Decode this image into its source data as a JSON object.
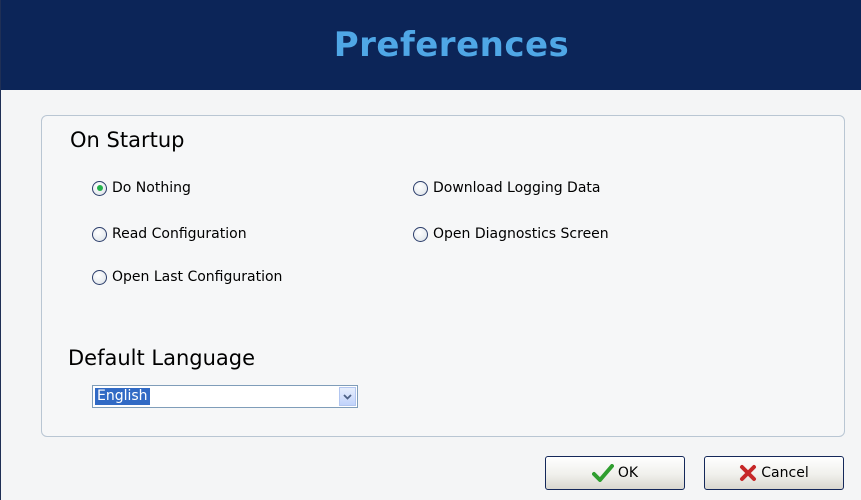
{
  "window": {
    "title": "Preferences"
  },
  "startup": {
    "title": "On Startup",
    "options": [
      {
        "label": "Do Nothing",
        "selected": true
      },
      {
        "label": "Read Configuration",
        "selected": false
      },
      {
        "label": "Open Last Configuration",
        "selected": false
      },
      {
        "label": "Download Logging Data",
        "selected": false
      },
      {
        "label": "Open Diagnostics Screen",
        "selected": false
      }
    ]
  },
  "language": {
    "title": "Default Language",
    "value": "English"
  },
  "buttons": {
    "ok": "OK",
    "cancel": "Cancel"
  },
  "colors": {
    "header_bg": "#0c2558",
    "title_text": "#4fa7e6",
    "radio_selected": "#22b14c",
    "ok_icon": "#2f9e2f",
    "cancel_icon": "#c62828",
    "selection_bg": "#316ac5"
  },
  "icons": {
    "ok": "checkmark-icon",
    "cancel": "x-icon",
    "dropdown": "chevron-down-icon"
  }
}
